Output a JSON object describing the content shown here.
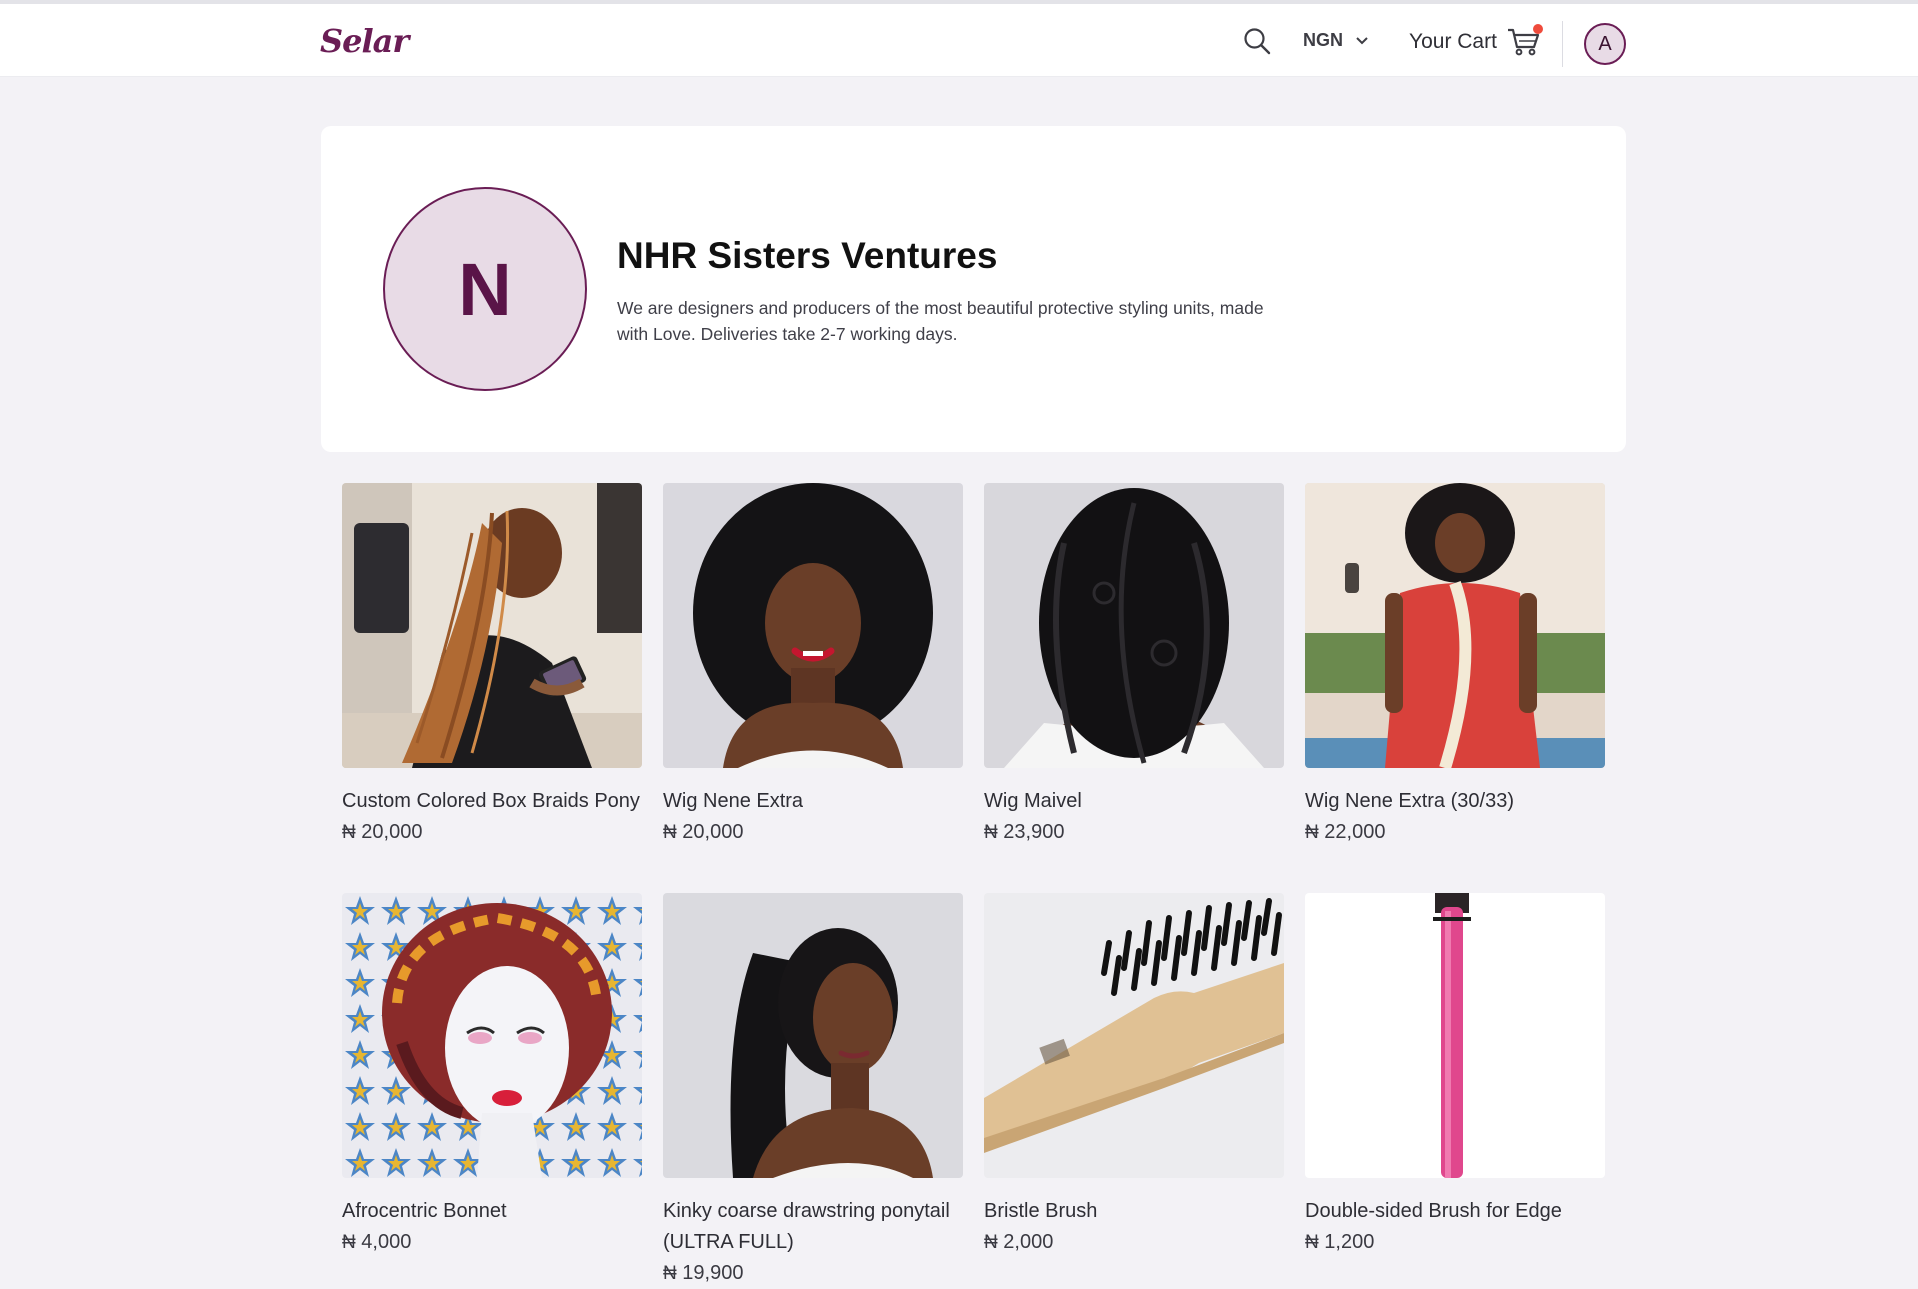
{
  "navbar": {
    "logo": "Selar",
    "currency": "NGN",
    "cart_label": "Your Cart",
    "avatar_initial": "A",
    "accent_color": "#6a1d55",
    "cart_badge_color": "#ef4b3c"
  },
  "store": {
    "initial": "N",
    "name": "NHR Sisters Ventures",
    "description": "We are designers and producers of the most beautiful protective styling units, made with Love. Deliveries take 2-7 working days."
  },
  "currency_symbol": "₦",
  "products": [
    {
      "title": "Custom Colored Box Braids Pony",
      "price": "20,000"
    },
    {
      "title": "Wig Nene Extra",
      "price": "20,000"
    },
    {
      "title": "Wig Maivel",
      "price": "23,900"
    },
    {
      "title": "Wig Nene Extra (30/33)",
      "price": "22,000"
    },
    {
      "title": "Afrocentric Bonnet",
      "price": "4,000"
    },
    {
      "title": "Kinky coarse drawstring ponytail (ULTRA FULL)",
      "price": "19,900"
    },
    {
      "title": "Bristle Brush",
      "price": "2,000"
    },
    {
      "title": "Double-sided Brush for Edge",
      "price": "1,200"
    }
  ]
}
